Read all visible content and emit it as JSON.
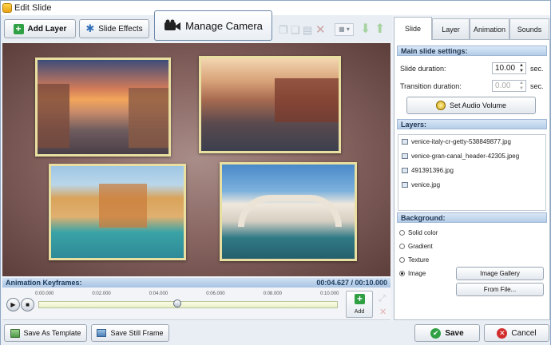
{
  "window": {
    "title": "Edit Slide"
  },
  "toolbar": {
    "add_layer": "Add Layer",
    "slide_effects": "Slide Effects",
    "manage_camera": "Manage Camera"
  },
  "keyframes": {
    "title": "Animation Keyframes:",
    "time": "00:04.627 / 00:10.000",
    "ticks": [
      "0:00.000",
      "0:02.000",
      "0:04.000",
      "0:06.000",
      "0:08.000",
      "0:10.000"
    ],
    "add_label": "Add",
    "playhead_fraction": 0.4627
  },
  "tabs": [
    "Slide",
    "Layer",
    "Animation",
    "Sounds"
  ],
  "main_settings": {
    "title": "Main slide settings:",
    "slide_duration_label": "Slide duration:",
    "slide_duration_value": "10.00",
    "transition_duration_label": "Transition duration:",
    "transition_duration_value": "0.00",
    "unit": "sec.",
    "set_audio": "Set Audio Volume"
  },
  "layers": {
    "title": "Layers:",
    "items": [
      "venice-italy-cr-getty-538849877.jpg",
      "venice-gran-canal_header-42305.jpeg",
      "491391396.jpg",
      "venice.jpg"
    ]
  },
  "background": {
    "title": "Background:",
    "options": [
      "Solid color",
      "Gradient",
      "Texture",
      "Image"
    ],
    "selected": "Image",
    "image_gallery": "Image Gallery",
    "from_file": "From File..."
  },
  "bottom": {
    "save_template": "Save As Template",
    "save_still": "Save Still Frame",
    "save": "Save",
    "cancel": "Cancel"
  },
  "colors": {
    "accent": "#2f6fb5",
    "save_green": "#2fa043",
    "cancel_red": "#d22d2d"
  }
}
